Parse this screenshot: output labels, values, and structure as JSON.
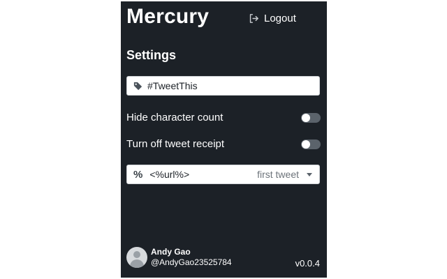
{
  "app": {
    "title": "Mercury"
  },
  "header": {
    "logout_label": "Logout"
  },
  "settings": {
    "heading": "Settings",
    "hashtag_value": "#TweetThis",
    "hide_char_count": {
      "label": "Hide character count",
      "enabled": false
    },
    "tweet_receipt": {
      "label": "Turn off tweet receipt",
      "enabled": false
    },
    "template": {
      "icon_glyph": "%",
      "value": "<%url%>",
      "selected_option": "first tweet"
    }
  },
  "user": {
    "name": "Andy Gao",
    "handle": "@AndyGao23525784"
  },
  "version": "v0.0.4",
  "colors": {
    "panel_bg": "#1c2127",
    "toggle_off": "#5b636b",
    "field_bg": "#ffffff"
  },
  "icons": {
    "logout": "logout-icon",
    "tag": "tag-icon",
    "percent": "percent-icon",
    "dropdown": "caret-down-icon",
    "avatar": "avatar-icon"
  }
}
